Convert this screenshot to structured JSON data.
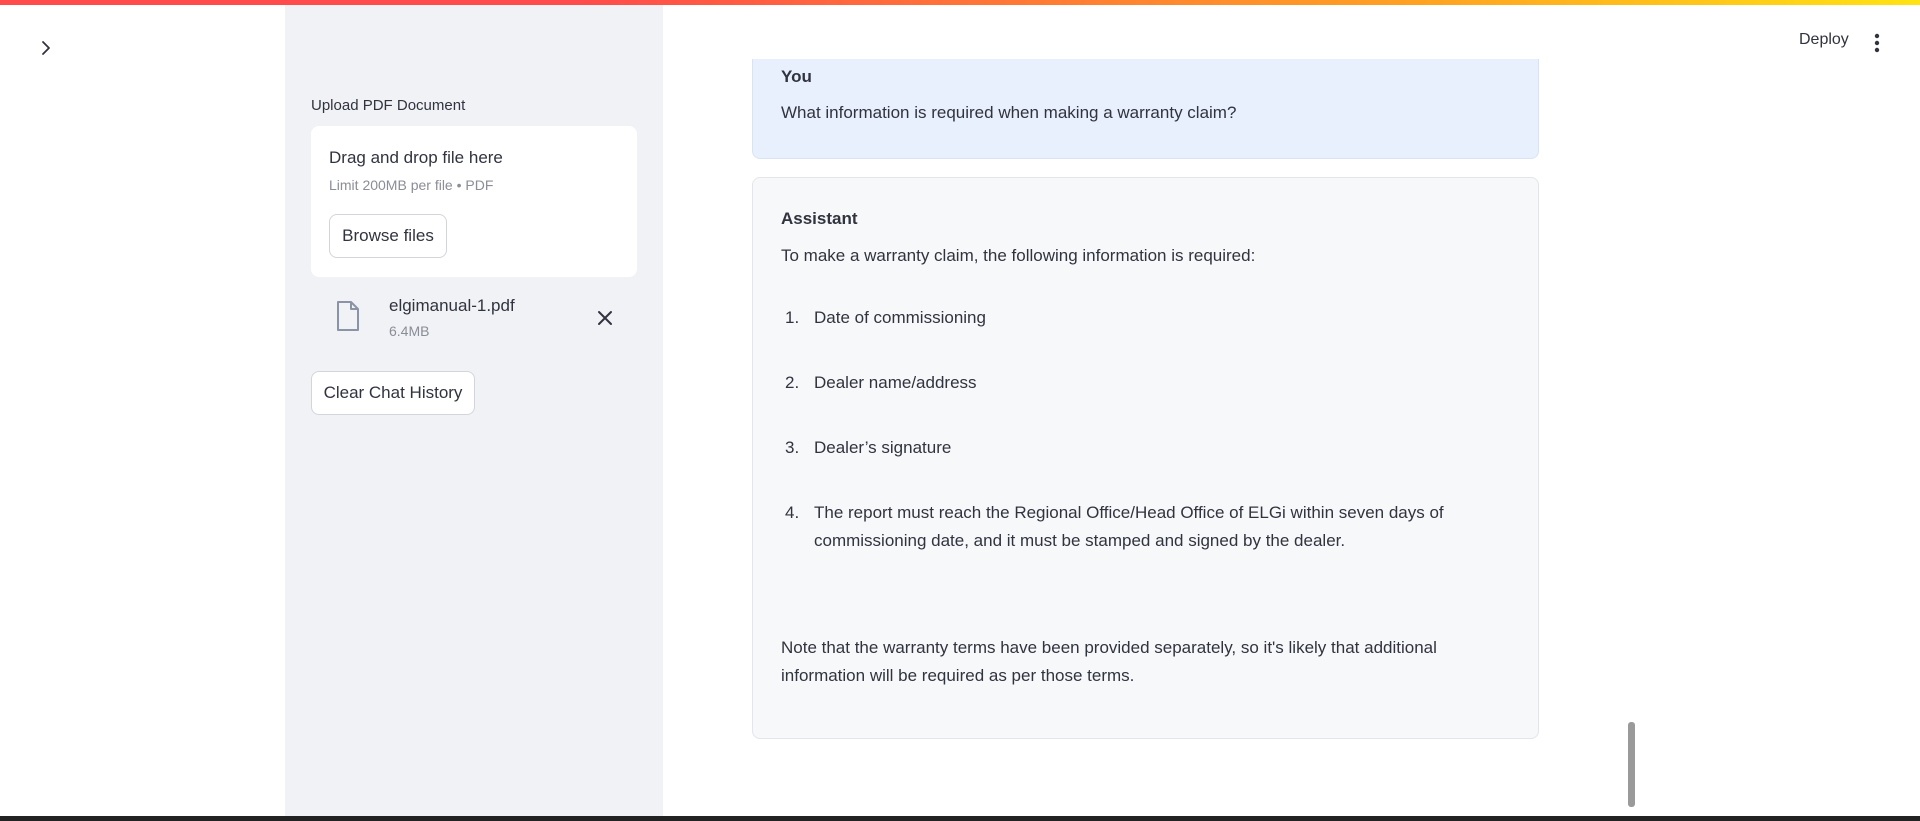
{
  "sidebar": {
    "upload_label": "Upload PDF Document",
    "dropzone": {
      "title": "Drag and drop file here",
      "limit": "Limit 200MB per file • PDF",
      "browse_label": "Browse files"
    },
    "file": {
      "name": "elgimanual-1.pdf",
      "size": "6.4MB"
    },
    "clear_label": "Clear Chat History"
  },
  "header": {
    "deploy_label": "Deploy"
  },
  "chat": {
    "user": {
      "role": "You",
      "text": "What information is required when making a warranty claim?"
    },
    "assistant": {
      "role": "Assistant",
      "intro": "To make a warranty claim, the following information is required:",
      "items": [
        {
          "num": "1.",
          "text": "Date of commissioning"
        },
        {
          "num": "2.",
          "text": "Dealer name/address"
        },
        {
          "num": "3.",
          "text": "Dealer’s signature"
        },
        {
          "num": "4.",
          "text": "The report must reach the Regional Office/Head Office of ELGi within seven days of commissioning date, and it must be stamped and signed by the dealer."
        }
      ],
      "note": "Note that the warranty terms have been provided separately, so it's likely that additional information will be required as per those terms."
    }
  },
  "icons": {
    "expand": "chevron-right-icon",
    "file": "file-icon",
    "remove": "close-icon",
    "menu": "more-vertical-icon"
  },
  "colors": {
    "sidebar_bg": "#f0f2f6",
    "user_msg_bg": "#e8f0fd",
    "assistant_msg_bg": "#f7f8fa",
    "accent_red": "#ff4b4b",
    "text": "#31333f"
  }
}
